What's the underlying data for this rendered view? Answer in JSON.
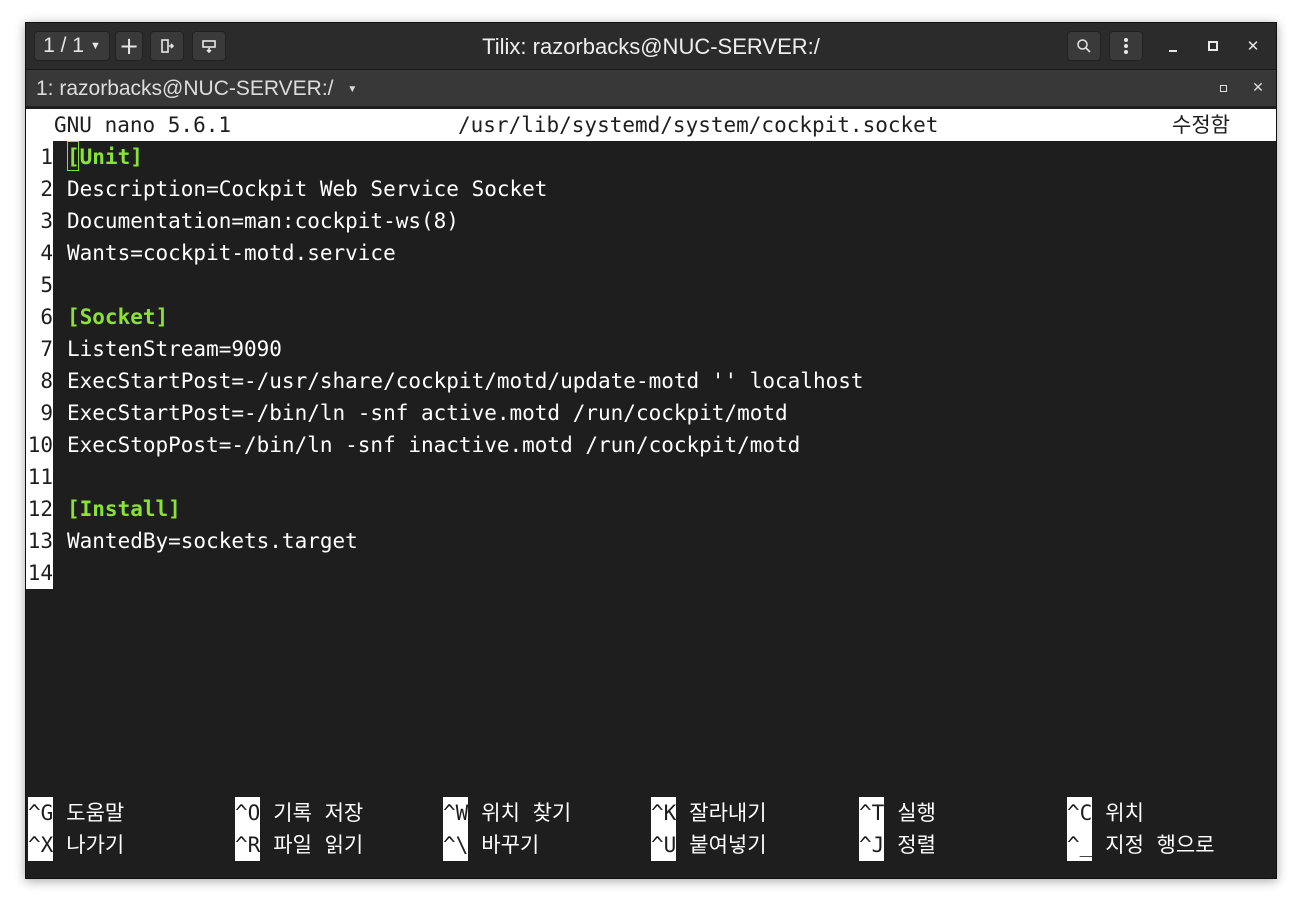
{
  "titlebar": {
    "session_counter": "1 / 1",
    "title": "Tilix: razorbacks@NUC-SERVER:/",
    "icons": {
      "dropdown": "chevron-down-icon",
      "add": "plus-icon",
      "split_right": "split-right-icon",
      "split_down": "split-down-icon",
      "search": "search-icon",
      "menu": "kebab-menu-icon",
      "minimize": "minimize-icon",
      "maximize": "maximize-icon",
      "close": "close-icon"
    }
  },
  "terminal_tab": {
    "title": "1: razorbacks@NUC-SERVER:/"
  },
  "nano": {
    "version": "GNU nano 5.6.1",
    "filename": "/usr/lib/systemd/system/cockpit.socket",
    "status": "수정함",
    "lines": [
      {
        "num": "1",
        "text": "[Unit]",
        "section": true
      },
      {
        "num": "2",
        "text": "Description=Cockpit Web Service Socket",
        "section": false
      },
      {
        "num": "3",
        "text": "Documentation=man:cockpit-ws(8)",
        "section": false
      },
      {
        "num": "4",
        "text": "Wants=cockpit-motd.service",
        "section": false
      },
      {
        "num": "5",
        "text": "",
        "section": false
      },
      {
        "num": "6",
        "text": "[Socket]",
        "section": true
      },
      {
        "num": "7",
        "text": "ListenStream=9090",
        "section": false
      },
      {
        "num": "8",
        "text": "ExecStartPost=-/usr/share/cockpit/motd/update-motd '' localhost",
        "section": false
      },
      {
        "num": "9",
        "text": "ExecStartPost=-/bin/ln -snf active.motd /run/cockpit/motd",
        "section": false
      },
      {
        "num": "10",
        "text": "ExecStopPost=-/bin/ln -snf inactive.motd /run/cockpit/motd",
        "section": false
      },
      {
        "num": "11",
        "text": "",
        "section": false
      },
      {
        "num": "12",
        "text": "[Install]",
        "section": true
      },
      {
        "num": "13",
        "text": "WantedBy=sockets.target",
        "section": false
      },
      {
        "num": "14",
        "text": "",
        "section": false
      }
    ],
    "shortcuts_row1": [
      {
        "key": "^G",
        "label": "도움말"
      },
      {
        "key": "^O",
        "label": "기록 저장"
      },
      {
        "key": "^W",
        "label": "위치 찾기"
      },
      {
        "key": "^K",
        "label": "잘라내기"
      },
      {
        "key": "^T",
        "label": "실행"
      },
      {
        "key": "^C",
        "label": "위치"
      }
    ],
    "shortcuts_row2": [
      {
        "key": "^X",
        "label": "나가기"
      },
      {
        "key": "^R",
        "label": "파일 읽기"
      },
      {
        "key": "^\\",
        "label": "바꾸기"
      },
      {
        "key": "^U",
        "label": "붙여넣기"
      },
      {
        "key": "^J",
        "label": "정렬"
      },
      {
        "key": "^_",
        "label": "지정 행으로"
      }
    ]
  },
  "colors": {
    "terminal_bg": "#1e1e1e",
    "section_green": "#8ae234",
    "titlebar_bg": "#2b2b2b"
  }
}
